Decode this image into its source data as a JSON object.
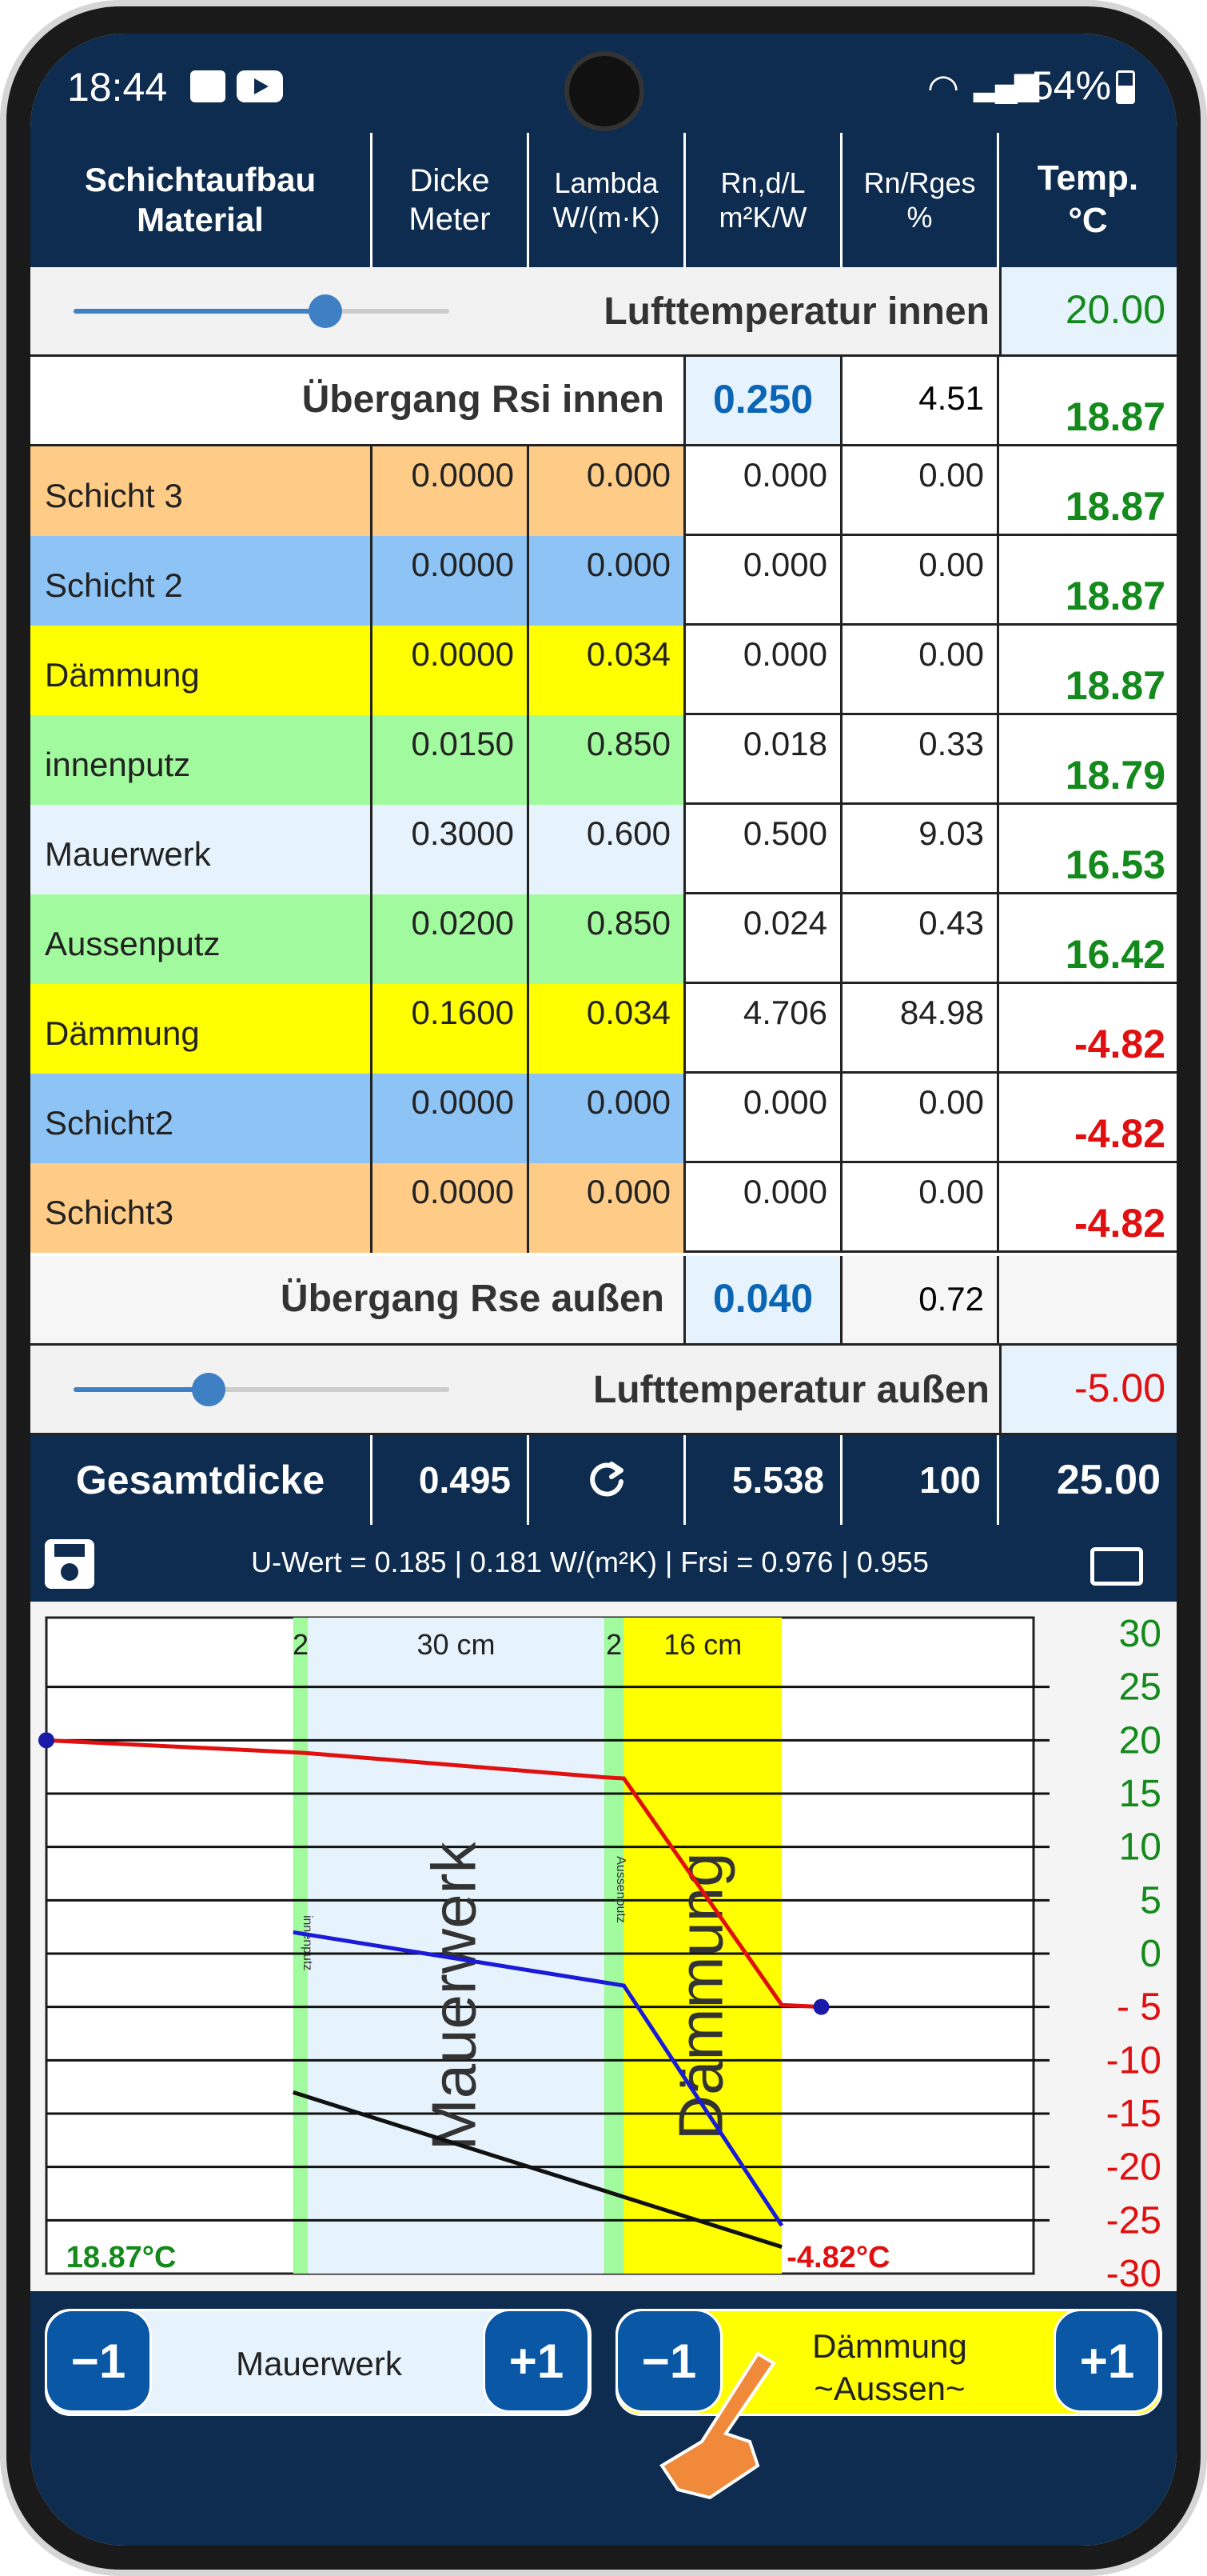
{
  "status_bar": {
    "time": "18:44",
    "battery": "54%"
  },
  "header": {
    "col1_line1": "Schichtaufbau",
    "col1_line2": "Material",
    "col2_line1": "Dicke",
    "col2_line2": "Meter",
    "col3_line1": "Lambda",
    "col3_line2": "W/(m·K)",
    "col4_line1": "Rn,d/L",
    "col4_line2": "m²K/W",
    "col5_line1": "Rn/Rges",
    "col5_line2": "%",
    "col6_line1": "Temp.",
    "col6_line2": "°C"
  },
  "inner_air": {
    "label": "Lufttemperatur innen",
    "value": "20.00",
    "slider_level": 0.67
  },
  "rsi": {
    "label": "Übergang Rsi innen",
    "value": "0.250",
    "percent": "4.51",
    "temp": "18.87"
  },
  "layers": [
    {
      "name": "Schicht 3",
      "thickness": "0.0000",
      "lambda": "0.000",
      "r": "0.000",
      "pct": "0.00",
      "temp": "18.87",
      "color": "#ffcc88",
      "temp_color": "green"
    },
    {
      "name": "Schicht 2",
      "thickness": "0.0000",
      "lambda": "0.000",
      "r": "0.000",
      "pct": "0.00",
      "temp": "18.87",
      "color": "#8ec4f5",
      "temp_color": "green"
    },
    {
      "name": "Dämmung",
      "thickness": "0.0000",
      "lambda": "0.034",
      "r": "0.000",
      "pct": "0.00",
      "temp": "18.87",
      "color": "#ffff00",
      "temp_color": "green"
    },
    {
      "name": "innenputz",
      "thickness": "0.0150",
      "lambda": "0.850",
      "r": "0.018",
      "pct": "0.33",
      "temp": "18.79",
      "color": "#a2fa9e",
      "temp_color": "green"
    },
    {
      "name": "Mauerwerk",
      "thickness": "0.3000",
      "lambda": "0.600",
      "r": "0.500",
      "pct": "9.03",
      "temp": "16.53",
      "color": "#e6f3fc",
      "temp_color": "green"
    },
    {
      "name": "Aussenputz",
      "thickness": "0.0200",
      "lambda": "0.850",
      "r": "0.024",
      "pct": "0.43",
      "temp": "16.42",
      "color": "#a2fa9e",
      "temp_color": "green"
    },
    {
      "name": "Dämmung",
      "thickness": "0.1600",
      "lambda": "0.034",
      "r": "4.706",
      "pct": "84.98",
      "temp": "-4.82",
      "color": "#ffff00",
      "temp_color": "red"
    },
    {
      "name": "Schicht2",
      "thickness": "0.0000",
      "lambda": "0.000",
      "r": "0.000",
      "pct": "0.00",
      "temp": "-4.82",
      "color": "#8ec4f5",
      "temp_color": "red"
    },
    {
      "name": "Schicht3",
      "thickness": "0.0000",
      "lambda": "0.000",
      "r": "0.000",
      "pct": "0.00",
      "temp": "-4.82",
      "color": "#ffcc88",
      "temp_color": "red"
    }
  ],
  "rse": {
    "label": "Übergang Rse außen",
    "value": "0.040",
    "percent": "0.72"
  },
  "outer_air": {
    "label": "Lufttemperatur außen",
    "value": "-5.00",
    "slider_level": 0.36
  },
  "totals": {
    "label": "Gesamtdicke",
    "thickness": "0.495",
    "r": "5.538",
    "pct": "100",
    "delta_t": "25.00"
  },
  "uwert": {
    "text": "U-Wert  = 0.185 | 0.181 W/(m²K)  |  Frsi = 0.976 | 0.955"
  },
  "chart_data": {
    "type": "line",
    "ylim": [
      -30,
      30
    ],
    "yticks": [
      "30",
      "25",
      "20",
      "15",
      "10",
      "5",
      "0",
      "- 5",
      "-10",
      "-15",
      "-20",
      "-25",
      "-30"
    ],
    "layer_labels": {
      "a": "2",
      "b": "30 cm",
      "c": "2",
      "d": "16 cm"
    },
    "zone_labels": {
      "mauerwerk": "Mauerwerk",
      "daemmung": "Dämmung",
      "innenputz": "innenputz",
      "aussenputz": "Aussenputz"
    },
    "inner_temp_label": "18.87°C",
    "outer_temp_label": "-4.82°C",
    "series": [
      {
        "color": "#e01010",
        "points": [
          [
            0,
            20.0
          ],
          [
            0.25,
            18.87
          ],
          [
            0.265,
            18.79
          ],
          [
            0.565,
            16.53
          ],
          [
            0.585,
            16.42
          ],
          [
            0.745,
            -4.82
          ],
          [
            0.785,
            -5.0
          ]
        ]
      }
    ]
  },
  "bottom": {
    "left_minus": "−1",
    "left_label": "Mauerwerk",
    "left_plus": "+1",
    "right_minus": "−1",
    "right_label_1": "Dämmung",
    "right_label_2": "~Aussen~",
    "right_plus": "+1"
  }
}
